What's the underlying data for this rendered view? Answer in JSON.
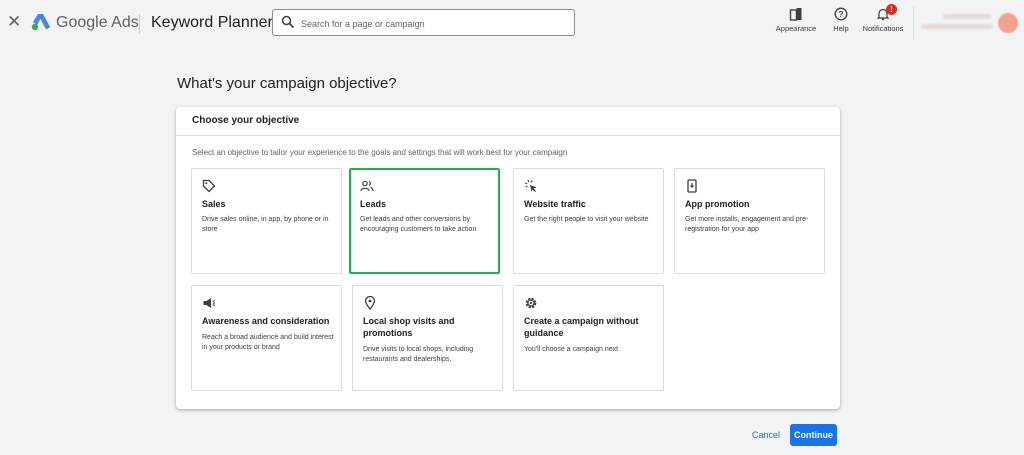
{
  "header": {
    "close_icon": "close-icon",
    "brand": "Google Ads",
    "tool_title": "Keyword Planner",
    "search_placeholder": "Search for a page or campaign",
    "actions": [
      {
        "label": "Appearance",
        "icon": "appearance-icon"
      },
      {
        "label": "Help",
        "icon": "help-icon"
      },
      {
        "label": "Notifications",
        "icon": "bell-icon",
        "badge": "!"
      }
    ]
  },
  "main": {
    "title": "What's your campaign objective?",
    "panel_heading": "Choose your objective",
    "panel_description": "Select an objective to tailor your experience to the goals and settings that will work best for your campaign",
    "objectives": [
      {
        "title": "Sales",
        "description": "Drive sales online, in app, by phone or in store",
        "icon": "tag-icon",
        "selected": false
      },
      {
        "title": "Leads",
        "description": "Get leads and other conversions by encouraging customers to take action",
        "icon": "people-icon",
        "selected": true
      },
      {
        "title": "Website traffic",
        "description": "Get the right people to visit your website",
        "icon": "cursor-click-icon",
        "selected": false
      },
      {
        "title": "App promotion",
        "description": "Get more installs, engagement and pre-registration for your app",
        "icon": "phone-icon",
        "selected": false
      },
      {
        "title": "Awareness and consideration",
        "description": "Reach a broad audience and build interest in your products or brand",
        "icon": "megaphone-icon",
        "selected": false
      },
      {
        "title": "Local shop visits and promotions",
        "description": "Drive visits to local shops, including restaurants and dealerships.",
        "icon": "location-pin-icon",
        "selected": false
      },
      {
        "title": "Create a campaign without guidance",
        "description": "You'll choose a campaign next",
        "icon": "gear-icon",
        "selected": false
      }
    ]
  },
  "footer": {
    "cancel_label": "Cancel",
    "continue_label": "Continue"
  },
  "colors": {
    "accent": "#1a73e8",
    "selected_border": "#1bb54c",
    "badge": "#d93025"
  }
}
